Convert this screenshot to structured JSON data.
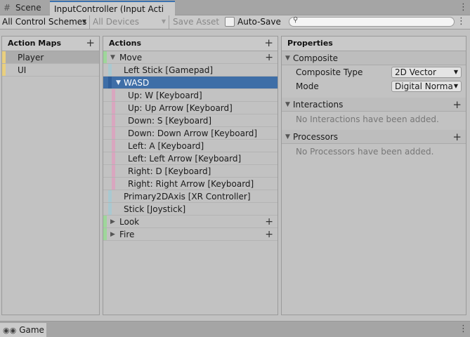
{
  "tabs": {
    "scene": "Scene",
    "active": "InputController (Input Acti"
  },
  "toolbar": {
    "control_schemes": "All Control Schemes",
    "devices": "All Devices",
    "save_asset": "Save Asset",
    "auto_save": "Auto-Save",
    "search_placeholder": ""
  },
  "action_maps": {
    "title": "Action Maps",
    "items": [
      "Player",
      "UI"
    ]
  },
  "actions": {
    "title": "Actions",
    "rows": [
      {
        "label": "Move"
      },
      {
        "label": "Left Stick [Gamepad]"
      },
      {
        "label": "WASD"
      },
      {
        "label": "Up: W [Keyboard]"
      },
      {
        "label": "Up: Up Arrow [Keyboard]"
      },
      {
        "label": "Down: S [Keyboard]"
      },
      {
        "label": "Down: Down Arrow [Keyboard]"
      },
      {
        "label": "Left: A [Keyboard]"
      },
      {
        "label": "Left: Left Arrow [Keyboard]"
      },
      {
        "label": "Right: D [Keyboard]"
      },
      {
        "label": "Right: Right Arrow [Keyboard]"
      },
      {
        "label": "Primary2DAxis [XR Controller]"
      },
      {
        "label": "Stick [Joystick]"
      },
      {
        "label": "Look"
      },
      {
        "label": "Fire"
      }
    ]
  },
  "properties": {
    "title": "Properties",
    "composite": {
      "header": "Composite",
      "type_label": "Composite Type",
      "type_value": "2D Vector",
      "mode_label": "Mode",
      "mode_value": "Digital Normali"
    },
    "interactions": {
      "header": "Interactions",
      "empty": "No Interactions have been added."
    },
    "processors": {
      "header": "Processors",
      "empty": "No Processors have been added."
    }
  },
  "bottom": {
    "game_tab": "Game"
  },
  "colors": {
    "selection": "#3e6ea7",
    "map_bar": "#e9cf7f",
    "action_bar": "#9ed69a",
    "binding_bar": "#a9c9d1",
    "part_bar": "#d9a6bf"
  }
}
